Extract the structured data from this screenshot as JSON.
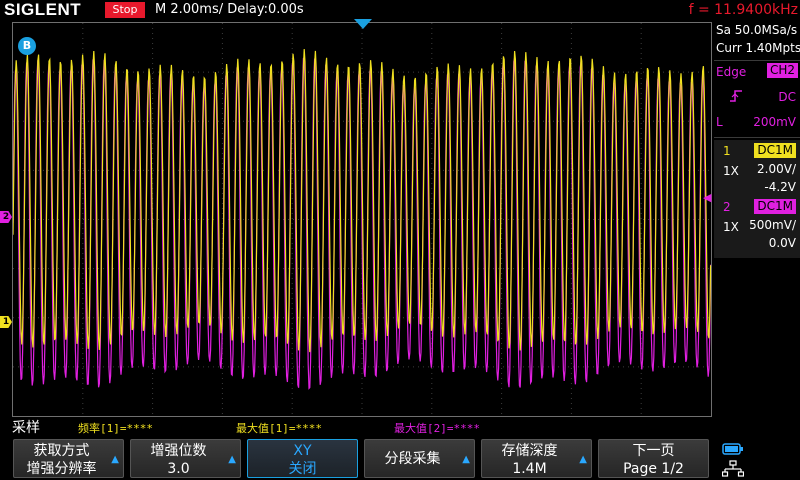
{
  "header": {
    "brand": "SIGLENT",
    "run_state": "Stop",
    "timebase": "M 2.00ms/ Delay:0.00s",
    "frequency": "f = 11.9400kHz"
  },
  "acquisition": {
    "sample_rate": "Sa 50.0MSa/s",
    "memory_depth": "Curr 1.40Mpts"
  },
  "trigger": {
    "type": "Edge",
    "source": "CH2",
    "coupling": "DC",
    "level_label": "L",
    "level": "200mV",
    "slope_icon": "rising-edge-icon",
    "marker_badge": "B"
  },
  "channels": [
    {
      "number": "1",
      "impedance": "DC1M",
      "probe": "1X",
      "scale": "2.00V/",
      "offset": "-4.2V",
      "color": "#f0e020",
      "marker": "1"
    },
    {
      "number": "2",
      "impedance": "DC1M",
      "probe": "1X",
      "scale": "500mV/",
      "offset": "0.0V",
      "color": "#e020e0",
      "marker": "2"
    }
  ],
  "measurements": {
    "menu_title": "采样",
    "items": [
      {
        "text": "频率[1]=****",
        "color": "#f0e020"
      },
      {
        "text": "最大值[1]=****",
        "color": "#f0e020"
      },
      {
        "text": "最大值[2]=****",
        "color": "#e020e0"
      }
    ]
  },
  "softkeys": [
    {
      "line1": "获取方式",
      "line2": "增强分辨率",
      "arrow": "▲"
    },
    {
      "line1": "增强位数",
      "line2": "3.0",
      "arrow": "▲"
    },
    {
      "line1": "XY",
      "line2": "关闭",
      "selected": true
    },
    {
      "line1": "分段采集",
      "arrow": "▲"
    },
    {
      "line1": "存储深度",
      "line2": "1.4M",
      "arrow": "▲"
    },
    {
      "line1": "下一页",
      "line2": "Page 1/2"
    }
  ],
  "tray_icons": [
    "battery-icon",
    "network-icon"
  ],
  "colors": {
    "ch1": "#f0e020",
    "ch2": "#e020e0",
    "accent": "#1aa0e0",
    "stop": "#e8192c"
  }
}
